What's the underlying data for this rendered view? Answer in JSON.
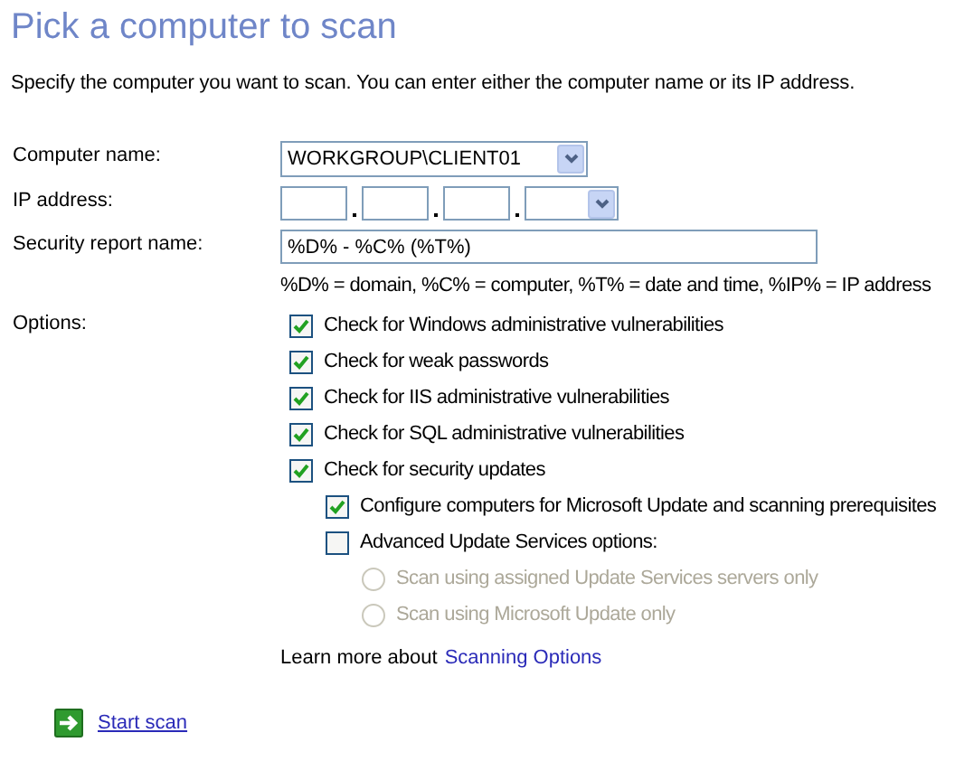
{
  "title": "Pick a computer to scan",
  "description": "Specify the computer you want to scan. You can enter either the computer name or its IP address.",
  "computer_name": {
    "label": "Computer name:",
    "value": "WORKGROUP\\CLIENT01"
  },
  "ip_address": {
    "label": "IP address:"
  },
  "security_report_name": {
    "label": "Security report name:",
    "value": "%D% - %C% (%T%)",
    "hint": "%D% = domain, %C% = computer, %T% = date and time, %IP% = IP address"
  },
  "options": {
    "label": "Options:",
    "items": [
      {
        "kind": "checkbox",
        "label": "Check for Windows administrative vulnerabilities",
        "checked": true
      },
      {
        "kind": "checkbox",
        "label": "Check for weak passwords",
        "checked": true
      },
      {
        "kind": "checkbox",
        "label": "Check for IIS administrative vulnerabilities",
        "checked": true
      },
      {
        "kind": "checkbox",
        "label": "Check for SQL administrative vulnerabilities",
        "checked": true
      },
      {
        "kind": "checkbox",
        "label": "Check for security updates",
        "checked": true,
        "children": [
          {
            "kind": "checkbox",
            "label": "Configure computers for Microsoft Update and scanning prerequisites",
            "checked": true
          },
          {
            "kind": "checkbox",
            "label": "Advanced Update Services options:",
            "checked": false,
            "children": [
              {
                "kind": "radio",
                "label": "Scan using assigned Update Services servers only",
                "selected": false,
                "disabled": true
              },
              {
                "kind": "radio",
                "label": "Scan using Microsoft Update only",
                "selected": false,
                "disabled": true
              }
            ]
          }
        ]
      }
    ]
  },
  "learn_more": {
    "text": "Learn more about",
    "link": "Scanning Options"
  },
  "start_scan": "Start scan"
}
